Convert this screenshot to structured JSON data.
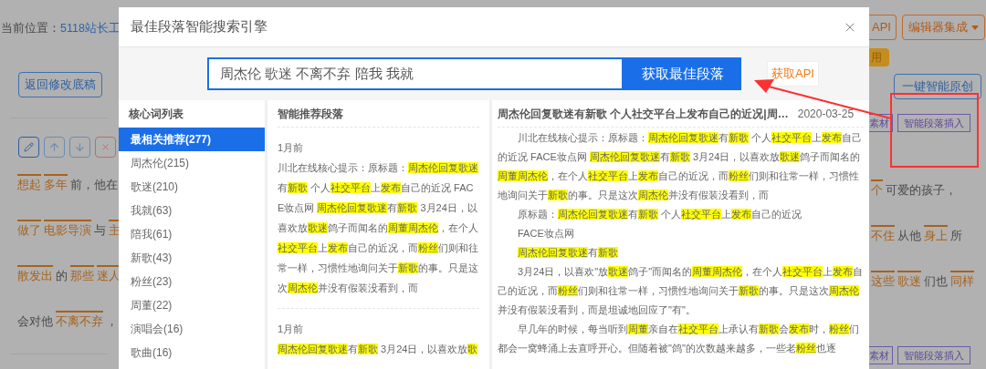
{
  "breadcrumb": {
    "label": "当前位置：",
    "link": "5118站长工"
  },
  "back_button": "返回修改底稿",
  "editor_lines_left": [
    [
      {
        "text": "想起",
        "keyword": true
      },
      {
        "text": "多年",
        "keyword": true
      },
      {
        "text": "前，他在",
        "keyword": false
      }
    ],
    [
      {
        "text": "做了",
        "keyword": true
      },
      {
        "text": "电影导演",
        "keyword": true
      },
      {
        "text": "与",
        "keyword": false
      },
      {
        "text": "主",
        "keyword": true
      }
    ],
    [
      {
        "text": "散发出",
        "keyword": true
      },
      {
        "text": "的",
        "keyword": false
      },
      {
        "text": "那些",
        "keyword": true
      },
      {
        "text": "迷人",
        "keyword": true
      }
    ],
    [
      {
        "text": "会对他",
        "keyword": false
      },
      {
        "text": "不离不弃",
        "keyword": true
      },
      {
        "text": "，",
        "keyword": false
      }
    ]
  ],
  "top_right_buttons": [
    {
      "label": "API",
      "kind": "plain"
    },
    {
      "label": "编辑器集成",
      "kind": "dropdown"
    }
  ],
  "badge": "用",
  "original_button": "一键智能原创",
  "insert_rows": [
    {
      "material": "素材",
      "insert": "智能段落插入"
    },
    {
      "material": "素材",
      "insert": "智能段落插入"
    }
  ],
  "editor_lines_right": [
    [
      {
        "text": "个",
        "keyword": true
      },
      {
        "text": "可爱的孩子，",
        "keyword": false
      }
    ],
    [
      {
        "text": "不住",
        "keyword": true
      },
      {
        "text": "从他",
        "keyword": false
      },
      {
        "text": "身上",
        "keyword": true
      },
      {
        "text": "所",
        "keyword": false
      }
    ],
    [
      {
        "text": "这些",
        "keyword": true
      },
      {
        "text": "歌迷",
        "keyword": true
      },
      {
        "text": "们也",
        "keyword": false
      },
      {
        "text": "同样",
        "keyword": true
      }
    ]
  ],
  "modal": {
    "title": "最佳段落智能搜索引擎",
    "search": {
      "value": "周杰伦 歌迷 不离不弃 陪我 我就",
      "button": "获取最佳段落",
      "api_button": "获取API"
    },
    "keywords": {
      "header": "核心词列表",
      "items": [
        {
          "label": "最相关推荐(277)",
          "selected": true
        },
        {
          "label": "周杰伦(215)",
          "selected": false
        },
        {
          "label": "歌迷(210)",
          "selected": false
        },
        {
          "label": "我就(63)",
          "selected": false
        },
        {
          "label": "陪我(61)",
          "selected": false
        },
        {
          "label": "新歌(43)",
          "selected": false
        },
        {
          "label": "粉丝(23)",
          "selected": false
        },
        {
          "label": "周董(22)",
          "selected": false
        },
        {
          "label": "演唱会(16)",
          "selected": false
        },
        {
          "label": "歌曲(16)",
          "selected": false
        }
      ]
    },
    "recommendations": {
      "header": "智能推荐段落",
      "cards": [
        {
          "time": "1月前",
          "segments": [
            {
              "text": "川北在线核心提示：原标题：",
              "highlighted": false
            },
            {
              "text": "周杰伦回复歌迷",
              "highlighted": true
            },
            {
              "text": "有",
              "highlighted": false
            },
            {
              "text": "新歌",
              "highlighted": true
            },
            {
              "text": " 个人",
              "highlighted": false
            },
            {
              "text": "社交平台",
              "highlighted": true
            },
            {
              "text": "上",
              "highlighted": false
            },
            {
              "text": "发布",
              "highlighted": true
            },
            {
              "text": "自己的近况 FACE妆点网 ",
              "highlighted": false
            },
            {
              "text": "周杰伦回复歌迷",
              "highlighted": true
            },
            {
              "text": "有",
              "highlighted": false
            },
            {
              "text": "新歌",
              "highlighted": true
            },
            {
              "text": " 3月24日，以喜欢放",
              "highlighted": false
            },
            {
              "text": "歌迷",
              "highlighted": true
            },
            {
              "text": "鸽子而闻名的",
              "highlighted": false
            },
            {
              "text": "周董周杰伦",
              "highlighted": true
            },
            {
              "text": "，在个人",
              "highlighted": false
            },
            {
              "text": "社交平台",
              "highlighted": true
            },
            {
              "text": "上",
              "highlighted": false
            },
            {
              "text": "发布",
              "highlighted": true
            },
            {
              "text": "自己的近况，而",
              "highlighted": false
            },
            {
              "text": "粉丝",
              "highlighted": true
            },
            {
              "text": "们则和往常一样，习惯性地询问关于",
              "highlighted": false
            },
            {
              "text": "新歌",
              "highlighted": true
            },
            {
              "text": "的事。只是这次",
              "highlighted": false
            },
            {
              "text": "周杰伦",
              "highlighted": true
            },
            {
              "text": "并没有假装没看到，而",
              "highlighted": false
            }
          ]
        },
        {
          "time": "1月前",
          "segments": [
            {
              "text": "周杰伦回复歌迷",
              "highlighted": true
            },
            {
              "text": "有",
              "highlighted": false
            },
            {
              "text": "新歌",
              "highlighted": true
            },
            {
              "text": " 3月24日，以喜欢放",
              "highlighted": false
            },
            {
              "text": "歌",
              "highlighted": true
            }
          ]
        }
      ]
    },
    "detail": {
      "title": "周杰伦回复歌迷有新歌 个人社交平台上发布自己的近况|周…",
      "date": "2020-03-25",
      "paragraphs": [
        [
          {
            "text": "川北在线核心提示：原标题：",
            "highlighted": false
          },
          {
            "text": "周杰伦回复歌迷",
            "highlighted": true
          },
          {
            "text": "有",
            "highlighted": false
          },
          {
            "text": "新歌",
            "highlighted": true
          },
          {
            "text": " 个人",
            "highlighted": false
          },
          {
            "text": "社交平台",
            "highlighted": true
          },
          {
            "text": "上",
            "highlighted": false
          },
          {
            "text": "发布",
            "highlighted": true
          },
          {
            "text": "自己的近况 FACE妆点网 ",
            "highlighted": false
          },
          {
            "text": "周杰伦回复歌迷",
            "highlighted": true
          },
          {
            "text": "有",
            "highlighted": false
          },
          {
            "text": "新歌",
            "highlighted": true
          },
          {
            "text": " 3月24日，以喜欢放",
            "highlighted": false
          },
          {
            "text": "歌迷",
            "highlighted": true
          },
          {
            "text": "鸽子而闻名的",
            "highlighted": false
          },
          {
            "text": "周董周杰伦",
            "highlighted": true
          },
          {
            "text": "，在个人",
            "highlighted": false
          },
          {
            "text": "社交平台",
            "highlighted": true
          },
          {
            "text": "上",
            "highlighted": false
          },
          {
            "text": "发布",
            "highlighted": true
          },
          {
            "text": "自己的近况，而",
            "highlighted": false
          },
          {
            "text": "粉丝",
            "highlighted": true
          },
          {
            "text": "们则和往常一样，习惯性地询问关于",
            "highlighted": false
          },
          {
            "text": "新歌",
            "highlighted": true
          },
          {
            "text": "的事。只是这次",
            "highlighted": false
          },
          {
            "text": "周杰伦",
            "highlighted": true
          },
          {
            "text": "并没有假装没看到，而",
            "highlighted": false
          }
        ],
        [
          {
            "text": "原标题：",
            "highlighted": false
          },
          {
            "text": "周杰伦回复歌迷",
            "highlighted": true
          },
          {
            "text": "有",
            "highlighted": false
          },
          {
            "text": "新歌",
            "highlighted": true
          },
          {
            "text": " 个人",
            "highlighted": false
          },
          {
            "text": "社交平台",
            "highlighted": true
          },
          {
            "text": "上",
            "highlighted": false
          },
          {
            "text": "发布",
            "highlighted": true
          },
          {
            "text": "自己的近况",
            "highlighted": false
          }
        ],
        [
          {
            "text": "FACE妆点网",
            "highlighted": false
          }
        ],
        [
          {
            "text": "周杰伦回复歌迷",
            "highlighted": true
          },
          {
            "text": "有",
            "highlighted": false
          },
          {
            "text": "新歌",
            "highlighted": true
          }
        ],
        [
          {
            "text": "3月24日，以喜欢\"放",
            "highlighted": false
          },
          {
            "text": "歌迷",
            "highlighted": true
          },
          {
            "text": "鸽子\"而闻名的",
            "highlighted": false
          },
          {
            "text": "周董周杰伦",
            "highlighted": true
          },
          {
            "text": "，在个人",
            "highlighted": false
          },
          {
            "text": "社交平台",
            "highlighted": true
          },
          {
            "text": "上",
            "highlighted": false
          },
          {
            "text": "发布",
            "highlighted": true
          },
          {
            "text": "自己的近况，而",
            "highlighted": false
          },
          {
            "text": "粉丝",
            "highlighted": true
          },
          {
            "text": "们则和往常一样，习惯性地询问关于",
            "highlighted": false
          },
          {
            "text": "新歌",
            "highlighted": true
          },
          {
            "text": "的事。只是这次",
            "highlighted": false
          },
          {
            "text": "周杰伦",
            "highlighted": true
          },
          {
            "text": "并没有假装没看到，而是坦诚地回应了\"有\"。",
            "highlighted": false
          }
        ],
        [
          {
            "text": "早几年的时候，每当听到",
            "highlighted": false
          },
          {
            "text": "周董",
            "highlighted": true
          },
          {
            "text": "亲自在",
            "highlighted": false
          },
          {
            "text": "社交平台",
            "highlighted": true
          },
          {
            "text": "上承认有",
            "highlighted": false
          },
          {
            "text": "新歌",
            "highlighted": true
          },
          {
            "text": "会",
            "highlighted": false
          },
          {
            "text": "发布",
            "highlighted": true
          },
          {
            "text": "时，",
            "highlighted": false
          },
          {
            "text": "粉丝",
            "highlighted": true
          },
          {
            "text": "们都会一窝蜂涌上去直呼开心。但随着被\"鸽\"的次数越来越多，一些老",
            "highlighted": false
          },
          {
            "text": "粉丝",
            "highlighted": true
          },
          {
            "text": "也逐",
            "highlighted": false
          }
        ]
      ]
    }
  }
}
